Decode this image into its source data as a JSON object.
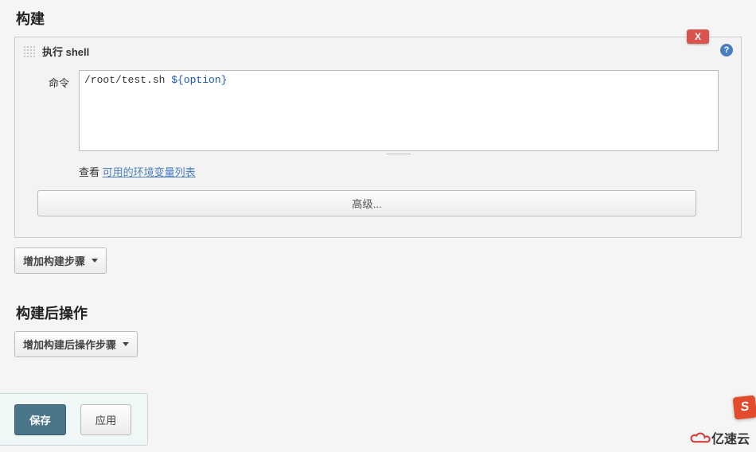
{
  "build_section": {
    "title": "构建",
    "step_title": "执行 shell",
    "delete_label": "X",
    "help_label": "?",
    "command_label": "命令",
    "command_value_plain": "/root/test.sh ",
    "command_value_var": "${option}",
    "hint_prefix": "查看 ",
    "hint_link": "可用的环境变量列表",
    "advanced_label": "高级...",
    "add_step_label": "增加构建步骤"
  },
  "post_section": {
    "title": "构建后操作",
    "add_step_label": "增加构建后操作步骤"
  },
  "footer": {
    "save_label": "保存",
    "apply_label": "应用"
  },
  "brand": {
    "text": "亿速云",
    "badge_letter": "S"
  },
  "colors": {
    "danger": "#d9534f",
    "primary": "#4b758b",
    "link": "#4a7fbf",
    "brand": "#d23d3d"
  }
}
